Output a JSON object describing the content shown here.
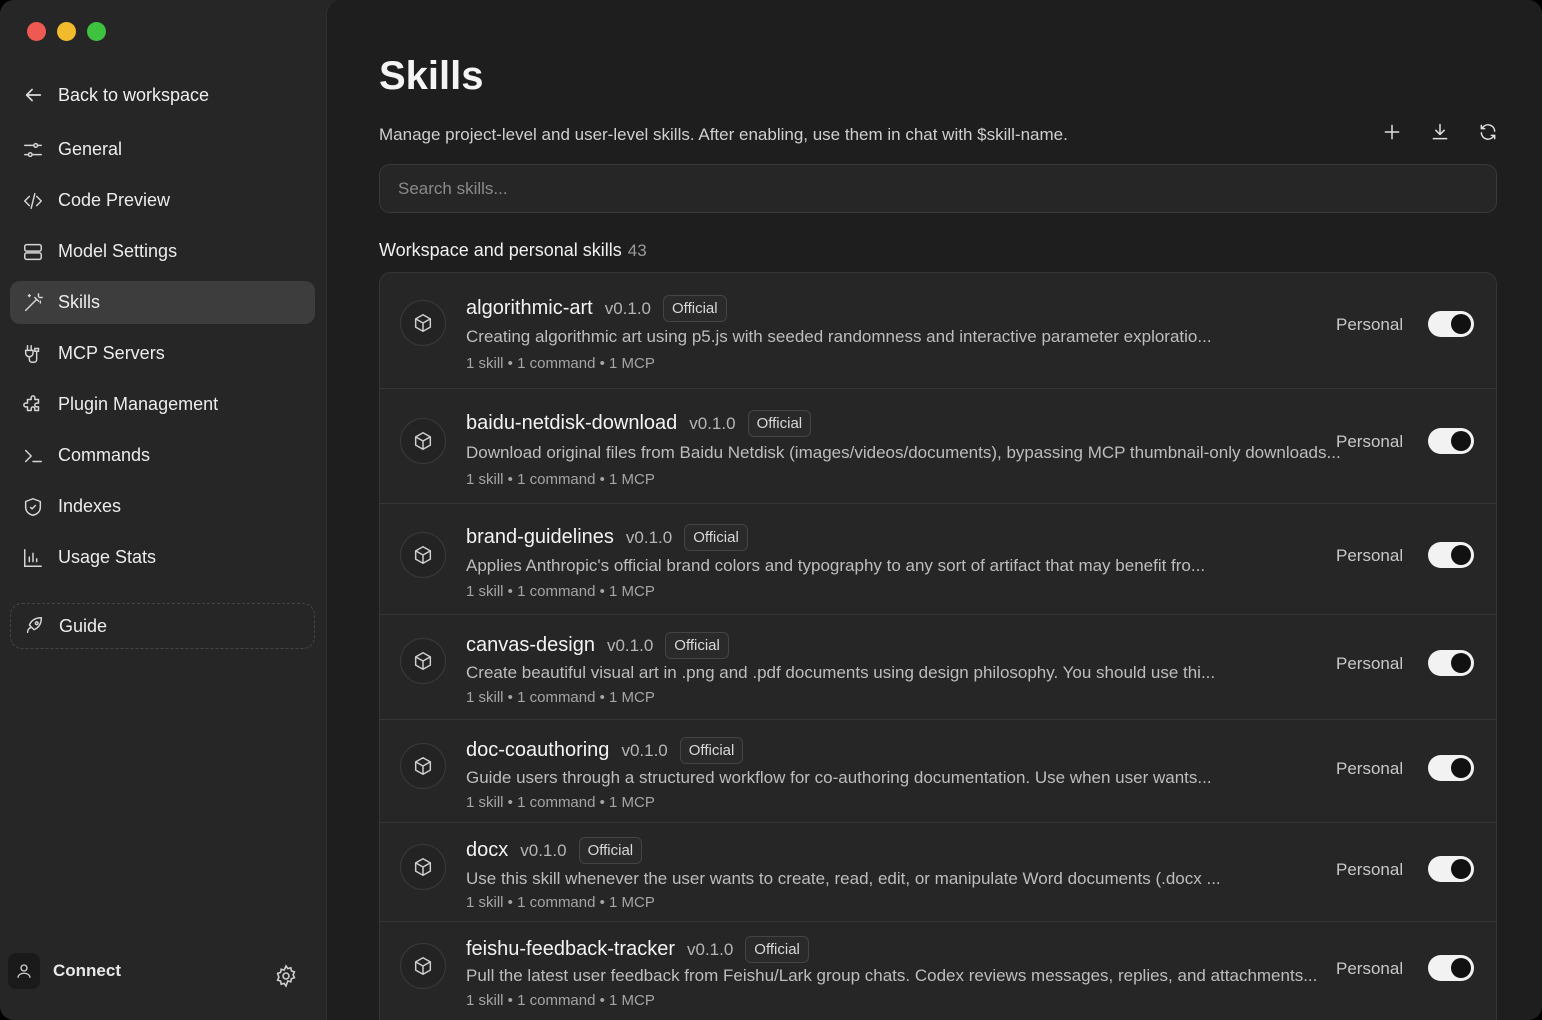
{
  "sidebar": {
    "back_label": "Back to workspace",
    "items": [
      {
        "label": "General",
        "icon": "sliders-icon"
      },
      {
        "label": "Code Preview",
        "icon": "code-icon"
      },
      {
        "label": "Model Settings",
        "icon": "server-icon"
      },
      {
        "label": "Skills",
        "icon": "magic-wand-icon",
        "active": true
      },
      {
        "label": "MCP Servers",
        "icon": "plug-icon"
      },
      {
        "label": "Plugin Management",
        "icon": "puzzle-icon"
      },
      {
        "label": "Commands",
        "icon": "terminal-icon"
      },
      {
        "label": "Indexes",
        "icon": "shield-icon"
      },
      {
        "label": "Usage Stats",
        "icon": "bar-chart-icon"
      }
    ],
    "guide_label": "Guide",
    "user_label": "Connect"
  },
  "main": {
    "title": "Skills",
    "subtitle": "Manage project-level and user-level skills. After enabling, use them in chat with $skill-name.",
    "search_placeholder": "Search skills...",
    "section_title": "Workspace and personal skills",
    "section_count": "43"
  },
  "skills": [
    {
      "name": "algorithmic-art",
      "version": "v0.1.0",
      "badge": "Official",
      "description": "Creating algorithmic art using p5.js with seeded randomness and interactive parameter exploratio...",
      "meta": "1 skill  •  1 command  •  1 MCP",
      "scope": "Personal",
      "enabled": true
    },
    {
      "name": "baidu-netdisk-download",
      "version": "v0.1.0",
      "badge": "Official",
      "description": "Download original files from Baidu Netdisk (images/videos/documents), bypassing MCP thumbnail-only downloads...",
      "meta": "1 skill  •  1 command  •  1 MCP",
      "scope": "Personal",
      "enabled": true
    },
    {
      "name": "brand-guidelines",
      "version": "v0.1.0",
      "badge": "Official",
      "description": "Applies Anthropic's official brand colors and typography to any sort of artifact that may benefit fro...",
      "meta": "1 skill  •  1 command  •  1 MCP",
      "scope": "Personal",
      "enabled": true
    },
    {
      "name": "canvas-design",
      "version": "v0.1.0",
      "badge": "Official",
      "description": "Create beautiful visual art in .png and .pdf documents using design philosophy. You should use thi...",
      "meta": "1 skill  •  1 command  •  1 MCP",
      "scope": "Personal",
      "enabled": true
    },
    {
      "name": "doc-coauthoring",
      "version": "v0.1.0",
      "badge": "Official",
      "description": "Guide users through a structured workflow for co-authoring documentation. Use when user wants...",
      "meta": "1 skill  •  1 command  •  1 MCP",
      "scope": "Personal",
      "enabled": true
    },
    {
      "name": "docx",
      "version": "v0.1.0",
      "badge": "Official",
      "description": "Use this skill whenever the user wants to create, read, edit, or manipulate Word documents (.docx ...",
      "meta": "1 skill  •  1 command  •  1 MCP",
      "scope": "Personal",
      "enabled": true
    },
    {
      "name": "feishu-feedback-tracker",
      "version": "v0.1.0",
      "badge": "Official",
      "description": "Pull the latest user feedback from Feishu/Lark group chats. Codex reviews messages, replies, and attachments...",
      "meta": "1 skill  •  1 command  •  1 MCP",
      "scope": "Personal",
      "enabled": true
    }
  ]
}
